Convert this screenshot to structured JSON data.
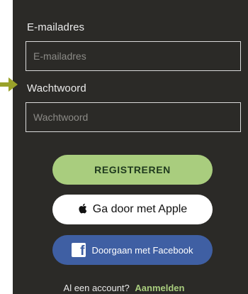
{
  "form": {
    "email_label": "E-mailadres",
    "email_placeholder": "E-mailadres",
    "email_value": "",
    "password_label": "Wachtwoord",
    "password_placeholder": "Wachtwoord",
    "password_value": ""
  },
  "buttons": {
    "register_label": "REGISTREREN",
    "apple_label": "Ga door met Apple",
    "facebook_label": "Doorgaan met Facebook"
  },
  "footer": {
    "prompt": "Al een account?",
    "login_label": "Aanmelden"
  },
  "icons": {
    "arrow": "arrow-right-icon",
    "apple": "apple-icon",
    "facebook": "facebook-icon"
  },
  "colors": {
    "panel_bg": "#2b2a27",
    "accent_green": "#a9cd7e",
    "facebook_blue": "#3f5fa3",
    "arrow": "#9aa22a"
  }
}
